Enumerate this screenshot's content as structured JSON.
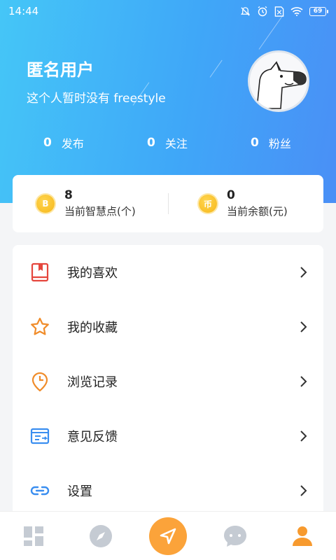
{
  "status_bar": {
    "time": "14:44",
    "battery": "69",
    "icons": [
      "bell-mute-icon",
      "alarm-icon",
      "sim-icon",
      "wifi-icon",
      "battery-icon"
    ]
  },
  "profile": {
    "name": "匿名用户",
    "bio": "这个人暂时没有 freestyle",
    "avatar_icon": "dog-avatar-icon"
  },
  "stats": [
    {
      "count": "0",
      "label": "发布"
    },
    {
      "count": "0",
      "label": "关注"
    },
    {
      "count": "0",
      "label": "粉丝"
    }
  ],
  "balance": {
    "points": {
      "value": "8",
      "label": "当前智慧点(个)",
      "icon": "points-coin-icon",
      "glyph": "B"
    },
    "money": {
      "value": "0",
      "label": "当前余额(元)",
      "icon": "currency-coin-icon",
      "glyph": "币"
    }
  },
  "menu": [
    {
      "label": "我的喜欢",
      "icon": "bookmark-book-icon"
    },
    {
      "label": "我的收藏",
      "icon": "star-icon"
    },
    {
      "label": "浏览记录",
      "icon": "clock-pin-icon"
    },
    {
      "label": "意见反馈",
      "icon": "feedback-icon"
    },
    {
      "label": "设置",
      "icon": "settings-link-icon"
    }
  ],
  "tabbar": {
    "tabs": [
      "dashboard-tab",
      "discover-tab",
      "send-tab",
      "chat-tab",
      "profile-tab"
    ],
    "active": "profile-tab"
  },
  "colors": {
    "header_start": "#45c6f7",
    "header_end": "#4a8ff6",
    "accent_orange": "#fba33a",
    "coin_gold": "#f6b71a",
    "icon_red": "#e5463d",
    "icon_orange": "#f08c2a",
    "icon_blue": "#3a8ef0"
  }
}
